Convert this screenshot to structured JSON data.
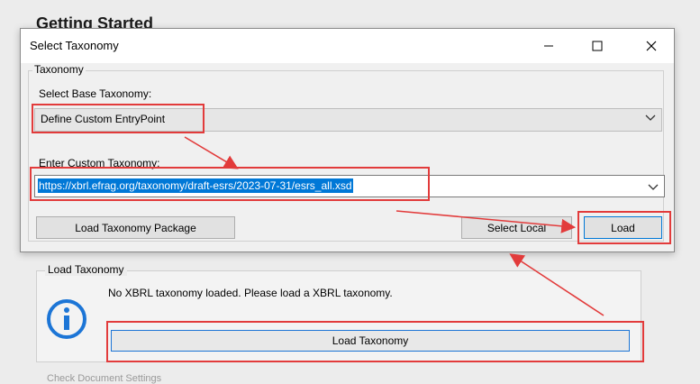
{
  "background": {
    "heading": "Getting Started",
    "group_label": "Load Taxonomy",
    "message": "No XBRL taxonomy loaded. Please load a XBRL taxonomy.",
    "load_button": "Load Taxonomy",
    "cut_text": "Check Document Settings"
  },
  "dialog": {
    "title": "Select Taxonomy",
    "group_label": "Taxonomy",
    "base_label": "Select Base Taxonomy:",
    "base_value": "Define Custom EntryPoint",
    "custom_label": "Enter Custom Taxonomy:",
    "custom_value": "https://xbrl.efrag.org/taxonomy/draft-esrs/2023-07-31/esrs_all.xsd",
    "package_button": "Load Taxonomy Package",
    "select_local_button": "Select Local",
    "load_button": "Load"
  },
  "colors": {
    "highlight": "#e23b3b",
    "accent": "#0078d7",
    "info": "#1c75d6"
  }
}
